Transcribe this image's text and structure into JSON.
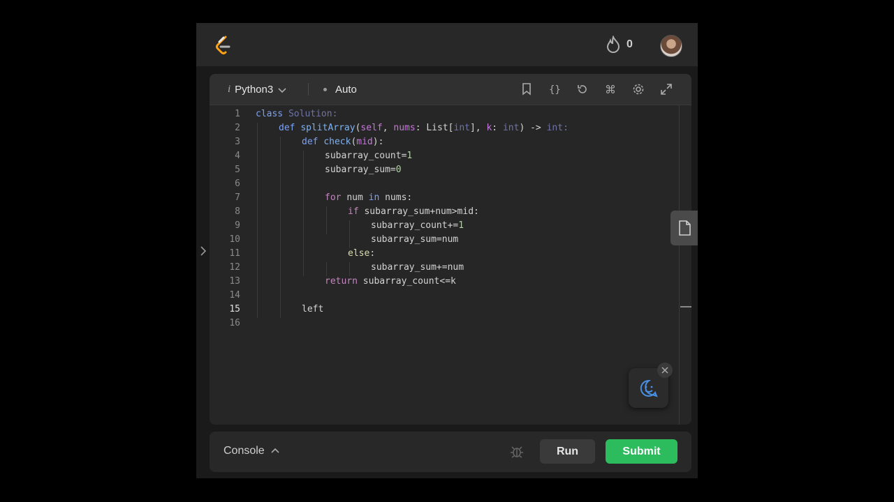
{
  "topbar": {
    "streak_count": "0"
  },
  "editor": {
    "language": "Python3",
    "language_prefix": "i",
    "mode": "Auto",
    "lines": [
      {
        "num": "1"
      },
      {
        "num": "2"
      },
      {
        "num": "3"
      },
      {
        "num": "4"
      },
      {
        "num": "5"
      },
      {
        "num": "6"
      },
      {
        "num": "7"
      },
      {
        "num": "8"
      },
      {
        "num": "9"
      },
      {
        "num": "10"
      },
      {
        "num": "11"
      },
      {
        "num": "12"
      },
      {
        "num": "13"
      },
      {
        "num": "14"
      },
      {
        "num": "15"
      },
      {
        "num": "16"
      }
    ],
    "code": {
      "l1_a": "class ",
      "l1_b": "Solution",
      ":": ":",
      "l2_def": "def ",
      "l2_fn": "splitArray",
      "l2_p1": "(",
      "l2_self": "self",
      ", ": ", ",
      "l2_nums": "nums",
      "l2_c1": ": List[",
      "l2_int1": "int",
      "l2_c2": "], ",
      "l2_k": "k",
      "l2_c3": ": ",
      "l2_int2": "int",
      "l2_c4": ") -> ",
      "l2_int3": "int",
      "l2_end": ":",
      "l3_def": "def ",
      "l3_fn": "check",
      "l3_p": "(",
      "l3_mid": "mid",
      "l3_end": "):",
      "l4": "subarray_count=",
      "l4_n": "1",
      "l5": "subarray_sum=",
      "l5_n": "0",
      "l7_for": "for ",
      "l7_a": "num ",
      "l7_in": "in ",
      "l7_b": "nums:",
      "l8_if": "if ",
      "l8_b": "subarray_sum+num>mid:",
      "l9": "subarray_count+=",
      "l9_n": "1",
      "l10": "subarray_sum=num",
      "l11": "else",
      ":2": ":",
      "l12": "subarray_sum+=num",
      "l13_ret": "return ",
      "l13_b": "subarray_count<=k",
      "l15": "left"
    }
  },
  "bottom": {
    "console_label": "Console",
    "run_label": "Run",
    "submit_label": "Submit"
  },
  "colors": {
    "accent_green": "#2cbb5d",
    "background": "#1a1a1a"
  },
  "icons": [
    "leetcode-logo-icon",
    "flame-icon",
    "chevron-down-icon",
    "bookmark-icon",
    "braces-icon",
    "reset-icon",
    "command-icon",
    "gear-icon",
    "fullscreen-icon",
    "file-icon",
    "chevron-right-icon",
    "chat-icon",
    "close-icon",
    "bug-icon",
    "chevron-up-icon"
  ]
}
